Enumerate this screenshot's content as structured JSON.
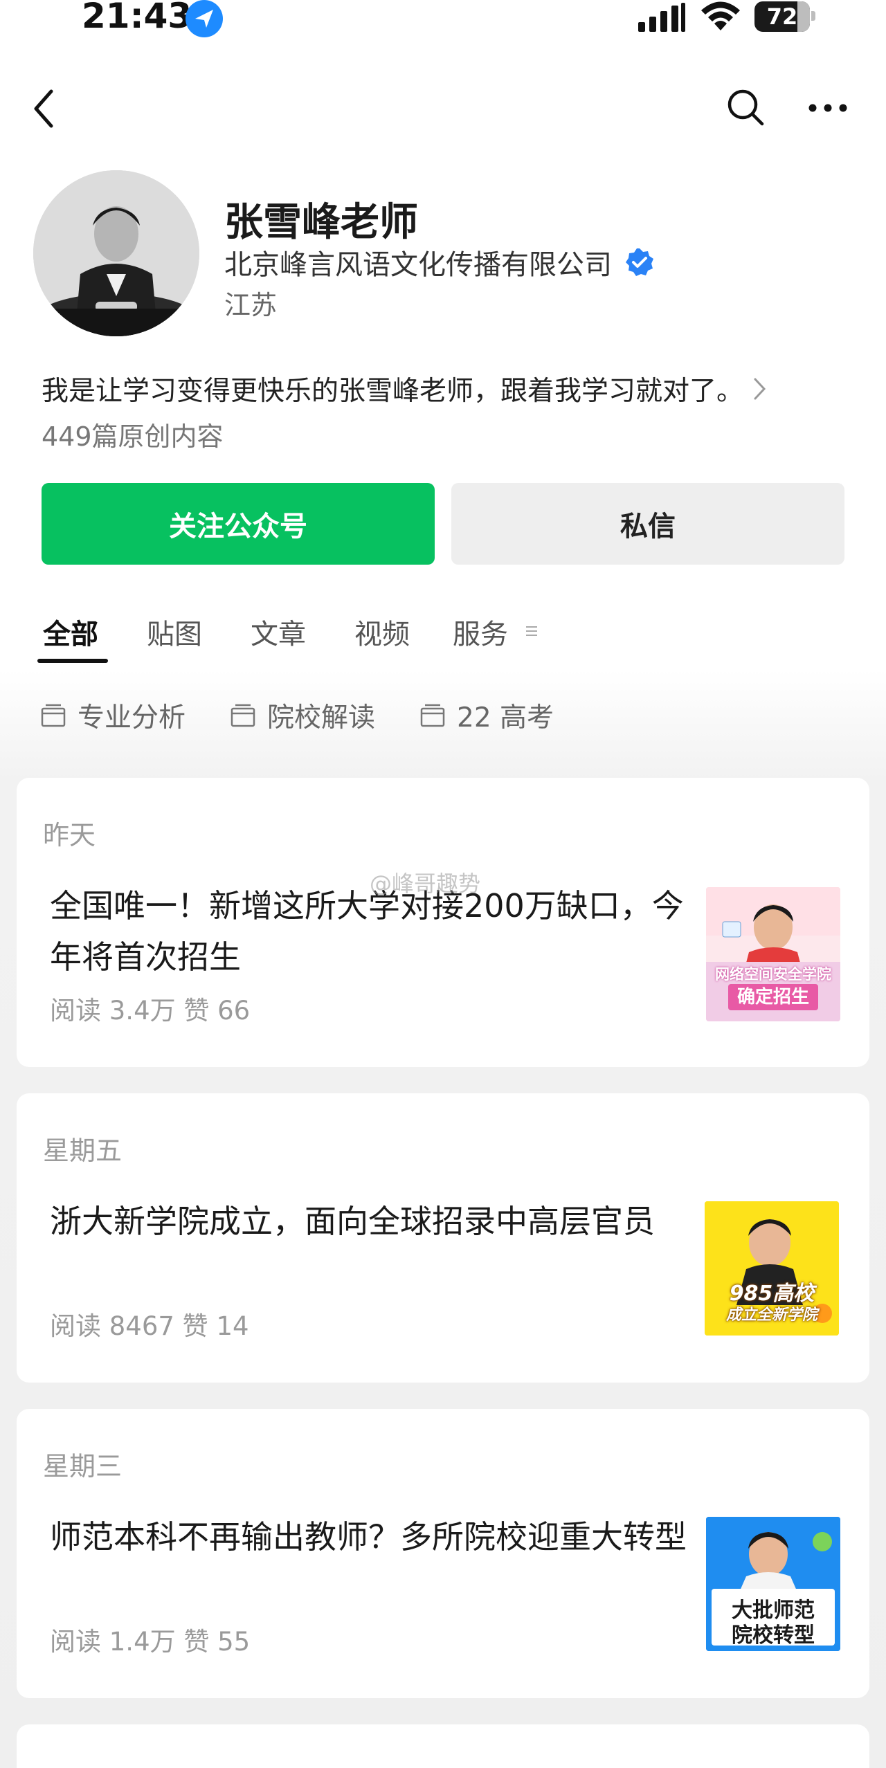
{
  "status_bar": {
    "time": "21:43",
    "battery": "72",
    "icons": [
      "location-arrow-icon",
      "cellular-signal-icon",
      "wifi-icon",
      "battery-icon"
    ]
  },
  "nav": {
    "icons": [
      "back-chevron-icon",
      "search-icon",
      "more-icon"
    ]
  },
  "profile": {
    "name": "张雪峰老师",
    "org": "北京峰言风语文化传播有限公司",
    "region": "江苏",
    "bio": "我是让学习变得更快乐的张雪峰老师，跟着我学习就对了。",
    "original_count": "449篇原创内容",
    "verified_color": "#2a82f6"
  },
  "actions": {
    "follow_label": "关注公众号",
    "message_label": "私信",
    "follow_color": "#07c160"
  },
  "tabs": [
    {
      "label": "全部",
      "active": true
    },
    {
      "label": "贴图",
      "active": false
    },
    {
      "label": "文章",
      "active": false
    },
    {
      "label": "视频",
      "active": false
    },
    {
      "label": "服务",
      "active": false
    }
  ],
  "tags": [
    {
      "label": "专业分析"
    },
    {
      "label": "院校解读"
    },
    {
      "label": "22 高考"
    }
  ],
  "articles": [
    {
      "date": "昨天",
      "title": "全国唯一！新增这所大学对接200万缺口，今年将首次招生",
      "stats": "阅读 3.4万   赞 66",
      "thumb_caption_1": "网络空间安全学院",
      "thumb_caption_2": "确定招生"
    },
    {
      "date": "星期五",
      "title": "浙大新学院成立，面向全球招录中高层官员",
      "stats": "阅读 8467   赞 14",
      "thumb_caption_1": "985高校",
      "thumb_caption_2": "成立全新学院"
    },
    {
      "date": "星期三",
      "title": "师范本科不再输出教师？多所院校迎重大转型",
      "stats": "阅读 1.4万   赞 55",
      "thumb_caption_1": "大批师范",
      "thumb_caption_2": "院校转型"
    }
  ],
  "watermark": "@峰哥趣势"
}
